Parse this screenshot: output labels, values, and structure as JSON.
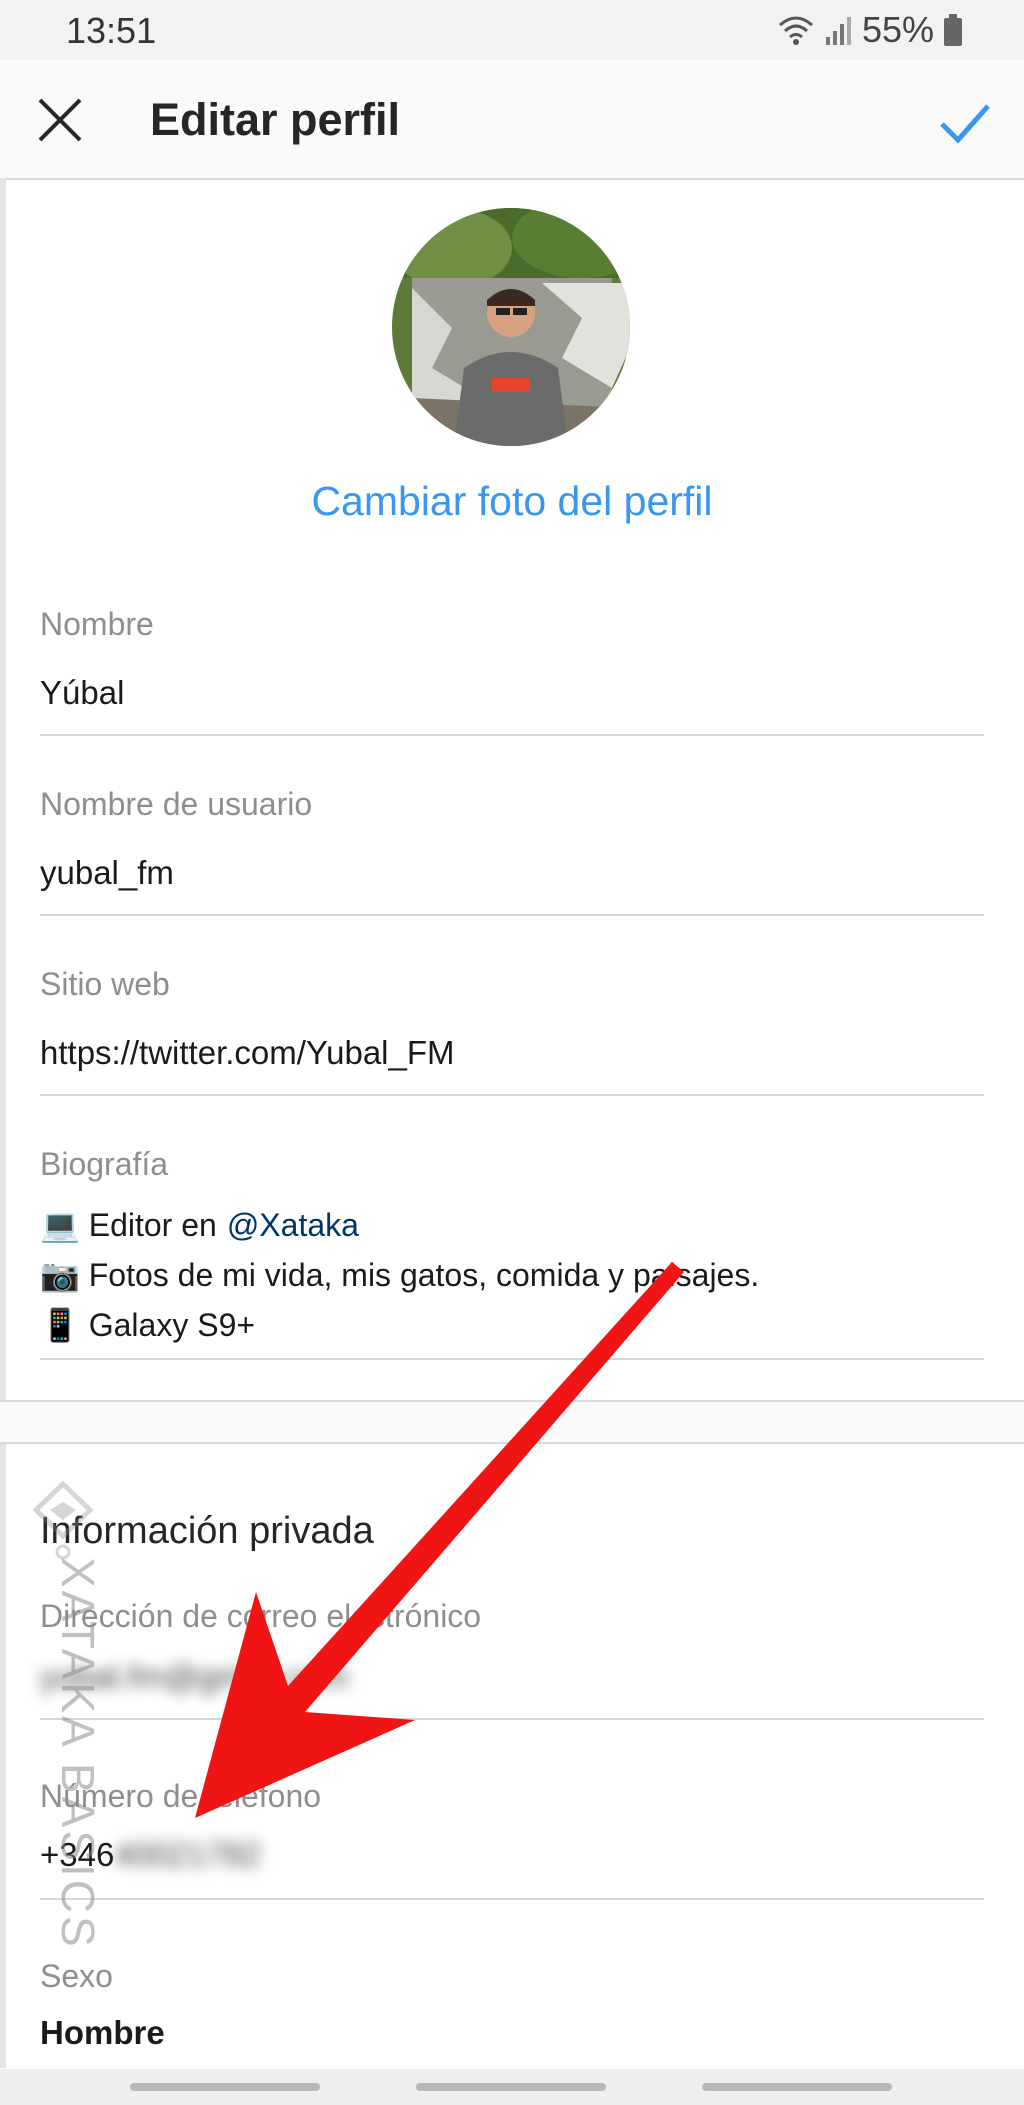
{
  "status_bar": {
    "time": "13:51",
    "battery": "55%",
    "icons": [
      "wifi-icon",
      "signal-icon",
      "battery-icon"
    ]
  },
  "app_bar": {
    "title": "Editar perfil",
    "close_icon": "close-icon",
    "confirm_icon": "check-icon",
    "accent_color": "#3897f0"
  },
  "profile": {
    "change_photo_label": "Cambiar foto del perfil"
  },
  "fields": {
    "name": {
      "label": "Nombre",
      "value": "Yúbal"
    },
    "username": {
      "label": "Nombre de usuario",
      "value": "yubal_fm"
    },
    "website": {
      "label": "Sitio web",
      "value": "https://twitter.com/Yubal_FM"
    },
    "bio": {
      "label": "Biografía",
      "line1_prefix": "💻 Editor en ",
      "line1_mention": "@Xataka",
      "line2": "📷 Fotos de mi vida, mis gatos, comida y paisajes.",
      "line3": "📱 Galaxy S9+"
    }
  },
  "private_info": {
    "title": "Información privada",
    "email": {
      "label": "Dirección de correo electrónico",
      "value": "yubal.fm@gmail.com"
    },
    "phone": {
      "label": "Número de teléfono",
      "visible_prefix": "+346",
      "hidden_value": "40021782"
    },
    "gender": {
      "label": "Sexo",
      "value": "Hombre"
    }
  },
  "watermark": {
    "text": "XATAKA BASICS"
  },
  "annotation": {
    "arrow_color": "#f01414"
  }
}
